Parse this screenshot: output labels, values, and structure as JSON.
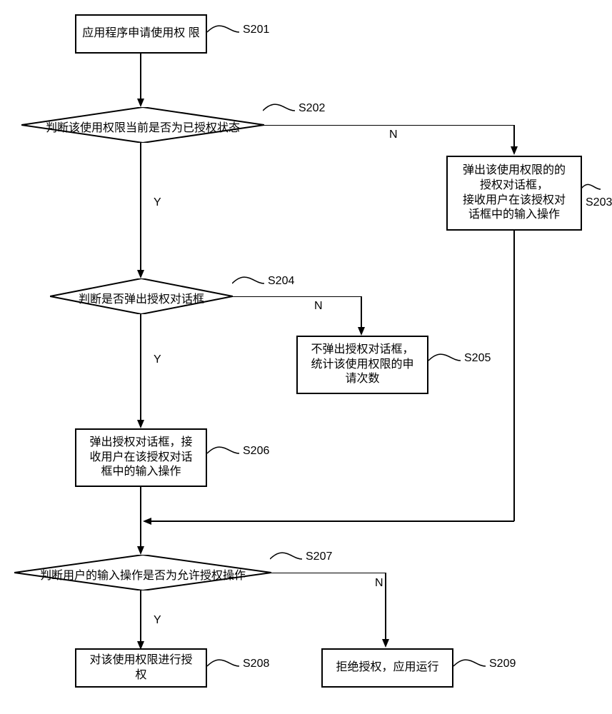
{
  "chart_data": {
    "type": "flowchart",
    "nodes": [
      {
        "id": "S201",
        "type": "process",
        "text": "应用程序申请使用权限"
      },
      {
        "id": "S202",
        "type": "decision",
        "text": "判断该使用权限当前是否为已授权状态"
      },
      {
        "id": "S203",
        "type": "process",
        "text": "弹出该使用权限的的授权对话框，接收用户在该授权对话框中的输入操作"
      },
      {
        "id": "S204",
        "type": "decision",
        "text": "判断是否弹出授权对话框"
      },
      {
        "id": "S205",
        "type": "process",
        "text": "不弹出授权对话框，统计该使用权限的申请次数"
      },
      {
        "id": "S206",
        "type": "process",
        "text": "弹出授权对话框，接收用户在该授权对话框中的输入操作"
      },
      {
        "id": "S207",
        "type": "decision",
        "text": "判断用户的输入操作是否为允许授权操作"
      },
      {
        "id": "S208",
        "type": "process",
        "text": "对该使用权限进行授权"
      },
      {
        "id": "S209",
        "type": "process",
        "text": "拒绝授权，应用运行"
      }
    ],
    "edges": [
      {
        "from": "S201",
        "to": "S202"
      },
      {
        "from": "S202",
        "to": "S204",
        "label": "Y"
      },
      {
        "from": "S202",
        "to": "S203",
        "label": "N"
      },
      {
        "from": "S203",
        "to": "S207"
      },
      {
        "from": "S204",
        "to": "S206",
        "label": "Y"
      },
      {
        "from": "S204",
        "to": "S205",
        "label": "N"
      },
      {
        "from": "S206",
        "to": "S207"
      },
      {
        "from": "S207",
        "to": "S208",
        "label": "Y"
      },
      {
        "from": "S207",
        "to": "S209",
        "label": "N"
      }
    ]
  },
  "nodes": {
    "s201": {
      "text": "应用程序申请使用权\n限",
      "label": "S201"
    },
    "s202": {
      "text": "判断该使用权限当前是否为已授权状态",
      "label": "S202"
    },
    "s203": {
      "text": "弹出该使用权限的的\n授权对话框，\n接收用户在该授权对\n话框中的输入操作",
      "label": "S203"
    },
    "s204": {
      "text": "判断是否弹出授权对话框",
      "label": "S204"
    },
    "s205": {
      "text": "不弹出授权对话框，\n统计该使用权限的申\n请次数",
      "label": "S205"
    },
    "s206": {
      "text": "弹出授权对话框，接\n收用户在该授权对话\n框中的输入操作",
      "label": "S206"
    },
    "s207": {
      "text": "判断用户的输入操作是否为允许授权操作",
      "label": "S207"
    },
    "s208": {
      "text": "对该使用权限进行授\n权",
      "label": "S208"
    },
    "s209": {
      "text": "拒绝授权，应用运行",
      "label": "S209"
    }
  },
  "branch": {
    "yes": "Y",
    "no": "N"
  }
}
